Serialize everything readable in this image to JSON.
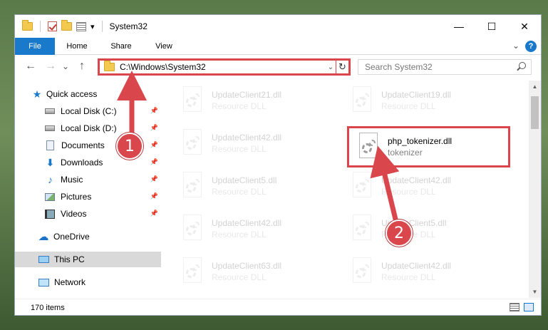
{
  "window": {
    "title": "System32",
    "controls": {
      "minimize": "—",
      "maximize": "☐",
      "close": "✕"
    }
  },
  "qat": {
    "dropdown": "▾"
  },
  "ribbon": {
    "tabs": [
      {
        "label": "File",
        "active": true
      },
      {
        "label": "Home"
      },
      {
        "label": "Share"
      },
      {
        "label": "View"
      }
    ],
    "collapse": "⌄",
    "help": "?"
  },
  "nav_buttons": {
    "back": "←",
    "forward": "→",
    "recent": "⌄",
    "up": "↑"
  },
  "address": {
    "path": "C:\\Windows\\System32",
    "dropdown": "⌄",
    "refresh": "↻"
  },
  "search": {
    "placeholder": "Search System32"
  },
  "navpane": {
    "items": [
      {
        "label": "Quick access",
        "icon": "star-icon",
        "pinned": false
      },
      {
        "label": "Local Disk (C:)",
        "icon": "drive-icon",
        "pinned": true
      },
      {
        "label": "Local Disk (D:)",
        "icon": "drive-icon",
        "pinned": true
      },
      {
        "label": "Documents",
        "icon": "documents-icon",
        "pinned": true
      },
      {
        "label": "Downloads",
        "icon": "downloads-icon",
        "pinned": true
      },
      {
        "label": "Music",
        "icon": "music-icon",
        "pinned": true
      },
      {
        "label": "Pictures",
        "icon": "pictures-icon",
        "pinned": true
      },
      {
        "label": "Videos",
        "icon": "videos-icon",
        "pinned": true
      },
      {
        "label": "OneDrive",
        "icon": "onedrive-icon",
        "pinned": false
      },
      {
        "label": "This PC",
        "icon": "this-pc-icon",
        "pinned": false,
        "selected": true
      },
      {
        "label": "Network",
        "icon": "network-icon",
        "pinned": false
      }
    ],
    "pin_glyph": "📌"
  },
  "files": [
    {
      "name": "UpdateClient21.dll",
      "type": "Resource DLL",
      "faded": true
    },
    {
      "name": "UpdateClient19.dll",
      "type": "Resource DLL",
      "faded": true
    },
    {
      "name": "UpdateClient42.dll",
      "type": "Resource DLL",
      "faded": true
    },
    {
      "name": "php_tokenizer.dll",
      "type": "tokenizer",
      "faded": false,
      "highlight": true
    },
    {
      "name": "UpdateClient5.dll",
      "type": "Resource DLL",
      "faded": true
    },
    {
      "name": "UpdateClient42.dll",
      "type": "Resource DLL",
      "faded": true
    },
    {
      "name": "UpdateClient42.dll",
      "type": "Resource DLL",
      "faded": true
    },
    {
      "name": "UpdateClient5.dll",
      "type": "Resource DLL",
      "faded": true
    },
    {
      "name": "UpdateClient63.dll",
      "type": "Resource DLL",
      "faded": true
    },
    {
      "name": "UpdateClient42.dll",
      "type": "Resource DLL",
      "faded": true
    }
  ],
  "scrollbar": {
    "up": "▲",
    "down": "▼"
  },
  "status": {
    "item_count": "170 items"
  },
  "annotations": [
    {
      "label": "1",
      "color": "#d9474d"
    },
    {
      "label": "2",
      "color": "#d9474d"
    }
  ]
}
